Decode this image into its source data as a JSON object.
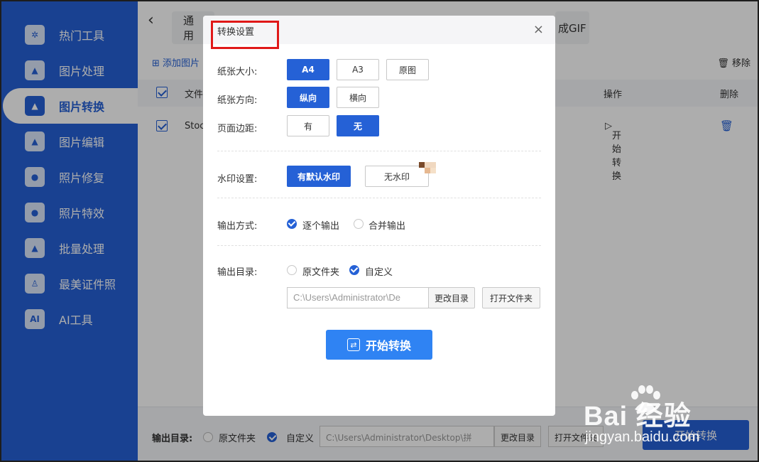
{
  "sidebar": {
    "items": [
      {
        "label": "热门工具",
        "icon": "tools-icon"
      },
      {
        "label": "图片处理",
        "icon": "image-process-icon"
      },
      {
        "label": "图片转换",
        "icon": "image-convert-icon",
        "active": true
      },
      {
        "label": "图片编辑",
        "icon": "image-edit-icon"
      },
      {
        "label": "照片修复",
        "icon": "photo-repair-icon"
      },
      {
        "label": "照片特效",
        "icon": "photo-effect-icon"
      },
      {
        "label": "批量处理",
        "icon": "batch-icon"
      },
      {
        "label": "最美证件照",
        "icon": "id-photo-icon"
      },
      {
        "label": "AI工具",
        "icon": "ai-icon",
        "glyph": "AI"
      }
    ]
  },
  "main": {
    "tab_left": "通用",
    "tab_right": "成GIF",
    "add_image": "添加图片",
    "remove": "移除",
    "columns": {
      "file": "文件",
      "action": "操作",
      "delete": "删除"
    },
    "row": {
      "file": "Stoc",
      "action": "开始转换"
    },
    "bottom": {
      "output_dir_label": "输出目录:",
      "original_folder": "原文件夹",
      "custom": "自定义",
      "path": "C:\\Users\\Administrator\\Desktop\\拼",
      "change_dir": "更改目录",
      "open_folder": "打开文件夹",
      "start": "开始转换"
    }
  },
  "dialog": {
    "title": "转换设置",
    "close": "×",
    "paper_size": {
      "label": "纸张大小:",
      "options": [
        "A4",
        "A3",
        "原图"
      ],
      "selected": "A4"
    },
    "orientation": {
      "label": "纸张方向:",
      "options": [
        "纵向",
        "横向"
      ],
      "selected": "纵向"
    },
    "margin": {
      "label": "页面边距:",
      "options": [
        "有",
        "无"
      ],
      "selected": "无"
    },
    "watermark": {
      "label": "水印设置:",
      "options": [
        "有默认水印",
        "无水印"
      ],
      "selected": "有默认水印"
    },
    "output_mode": {
      "label": "输出方式:",
      "options": [
        "逐个输出",
        "合并输出"
      ],
      "selected": "逐个输出"
    },
    "output_dir": {
      "label": "输出目录:",
      "options": [
        "原文件夹",
        "自定义"
      ],
      "selected": "自定义",
      "path_value": "C:\\Users\\Administrator\\De",
      "change_dir": "更改目录",
      "open_folder": "打开文件夹"
    },
    "start": "开始转换"
  },
  "watermark_overlay": {
    "brand": "Bai  经验",
    "url": "jingyan.baidu.com"
  },
  "colors": {
    "primary": "#2561d6",
    "start_button": "#2f83f3",
    "highlight": "#e01818"
  }
}
